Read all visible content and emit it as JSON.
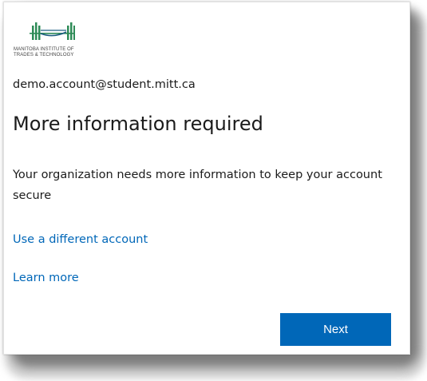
{
  "logo": {
    "name": "MANITOBA INSTITUTE OF\nTRADES & TECHNOLOGY",
    "icon": "mitt-bridge-logo-icon",
    "color": "#2e8b57"
  },
  "account_email": "demo.account@student.mitt.ca",
  "title": "More information required",
  "description": "Your organization needs more information to keep your account secure",
  "links": {
    "different_account": "Use a different account",
    "learn_more": "Learn more"
  },
  "next_button": "Next",
  "colors": {
    "link": "#0067b8",
    "button": "#0067b8",
    "text": "#1b1b1b"
  }
}
